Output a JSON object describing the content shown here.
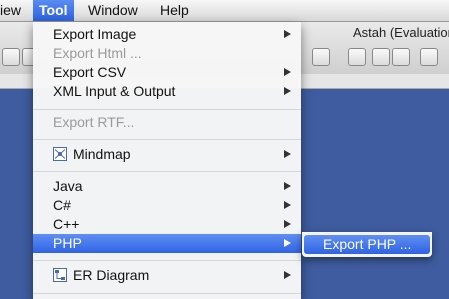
{
  "menubar": {
    "items": [
      "iew",
      "Tool",
      "Window",
      "Help"
    ],
    "active": "Tool"
  },
  "window": {
    "title": "Astah (Evaluation"
  },
  "menu": {
    "items": [
      {
        "label": "Export Image",
        "submenu": true,
        "disabled": false
      },
      {
        "label": "Export Html ...",
        "submenu": false,
        "disabled": true
      },
      {
        "label": "Export CSV",
        "submenu": true,
        "disabled": false
      },
      {
        "label": "XML Input & Output",
        "submenu": true,
        "disabled": false
      },
      {
        "label": "Export RTF...",
        "submenu": false,
        "disabled": true
      },
      {
        "label": "Mindmap",
        "submenu": true,
        "disabled": false,
        "icon": "mindmap-icon"
      },
      {
        "label": "Java",
        "submenu": true,
        "disabled": false
      },
      {
        "label": "C#",
        "submenu": true,
        "disabled": false
      },
      {
        "label": "C++",
        "submenu": true,
        "disabled": false
      },
      {
        "label": "PHP",
        "submenu": true,
        "disabled": false,
        "selected": true
      },
      {
        "label": "ER Diagram",
        "submenu": true,
        "disabled": false,
        "icon": "er-diagram-icon"
      }
    ]
  },
  "submenu": {
    "items": [
      {
        "label": "Export PHP ...",
        "selected": true
      }
    ]
  },
  "colors": {
    "selection": "#2f63e4",
    "canvas": "#3e5c9f",
    "disabled_text": "#9a9a9a"
  }
}
